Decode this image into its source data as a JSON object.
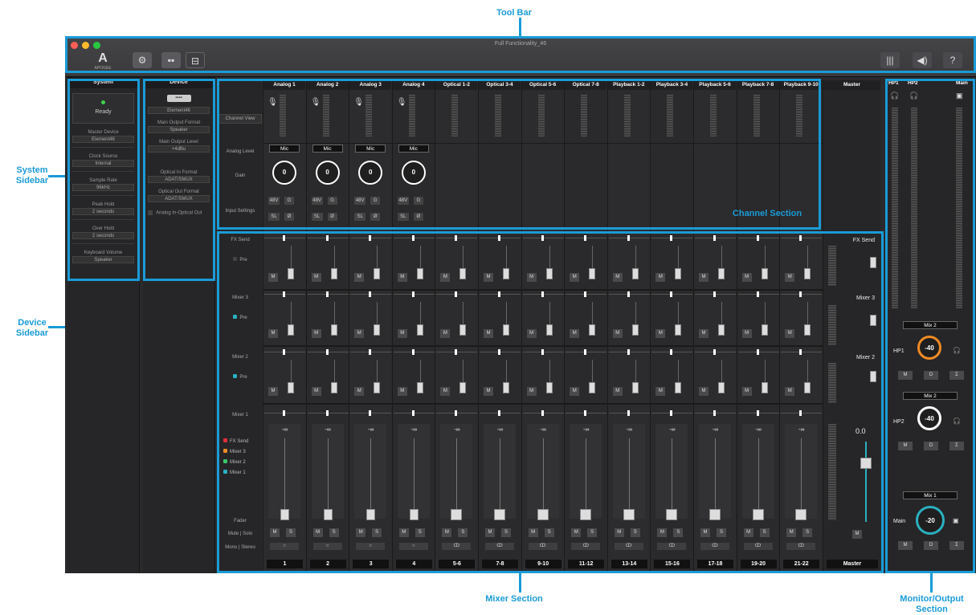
{
  "window": {
    "title": "Full Functionality_46"
  },
  "callouts": {
    "toolbar": "Tool Bar",
    "system_sidebar": "System\nSidebar",
    "device_sidebar": "Device\nSidebar",
    "channel_section": "Channel Section",
    "mixer_section": "Mixer Section",
    "monitor_section": "Monitor/Output\nSection"
  },
  "logo_text": "APOGEE",
  "system": {
    "header": "System",
    "status": "Ready",
    "status_color": "#3cd14a",
    "fields": [
      {
        "label": "Master Device",
        "value": "Element46"
      },
      {
        "label": "Clock Source",
        "value": "Internal"
      },
      {
        "label": "Sample Rate",
        "value": "96kHz"
      },
      {
        "label": "Peak Hold",
        "value": "2 seconds"
      },
      {
        "label": "Over Hold",
        "value": "2 seconds"
      },
      {
        "label": "Keyboard Volume",
        "value": "Speaker"
      }
    ]
  },
  "device": {
    "header": "Device",
    "name": "Element46",
    "fields": [
      {
        "label": "Main Output Format",
        "value": "Speaker"
      },
      {
        "label": "Main Output Level",
        "value": "+4dBu"
      },
      {
        "label": "Optical In Format",
        "value": "ADAT/SMUX"
      },
      {
        "label": "Optical Out Format",
        "value": "ADAT/SMUX"
      }
    ],
    "checkbox_label": "Analog In-Optical Out"
  },
  "row_labels": {
    "channel_view": "Channel View",
    "analog_level": "Analog Level",
    "gain": "Gain",
    "input_settings": "Input Settings",
    "fx_send": "FX Send",
    "pre": "Pre",
    "mixer3": "Mixer 3",
    "mixer2": "Mixer 2",
    "mixer1": "Mixer 1",
    "fader": "Fader",
    "mute_solo": "Mute | Solo",
    "mono_stereo": "Mono | Stereo"
  },
  "legend": [
    {
      "label": "FX Send",
      "color": "#e0303a"
    },
    {
      "label": "Mixer 3",
      "color": "#f08a24"
    },
    {
      "label": "Mixer 2",
      "color": "#3cc46a"
    },
    {
      "label": "Mixer 1",
      "color": "#2ab0c0"
    }
  ],
  "channels": [
    {
      "name": "Analog 1",
      "num": "1",
      "analog": true
    },
    {
      "name": "Analog 2",
      "num": "2",
      "analog": true
    },
    {
      "name": "Analog 3",
      "num": "3",
      "analog": true
    },
    {
      "name": "Analog 4",
      "num": "4",
      "analog": true
    },
    {
      "name": "Optical 1-2",
      "num": "5-6",
      "analog": false
    },
    {
      "name": "Optical 3-4",
      "num": "7-8",
      "analog": false
    },
    {
      "name": "Optical 5-6",
      "num": "9-10",
      "analog": false
    },
    {
      "name": "Optical 7-8",
      "num": "11-12",
      "analog": false
    },
    {
      "name": "Playback 1-2",
      "num": "13-14",
      "analog": false
    },
    {
      "name": "Playback 3-4",
      "num": "15-16",
      "analog": false
    },
    {
      "name": "Playback 5-6",
      "num": "17-18",
      "analog": false
    },
    {
      "name": "Playback 7-8",
      "num": "19-20",
      "analog": false
    },
    {
      "name": "Playback 9-10",
      "num": "21-22",
      "analog": false
    }
  ],
  "channel_controls": {
    "level": "Mic",
    "gain": "0",
    "btn48v": "48V",
    "btnG": "G",
    "btnSL": "SL",
    "btnPhase": "Ø",
    "mute": "M",
    "solo": "S",
    "fader_value": "-∞"
  },
  "master": {
    "header": "Master",
    "fx_send": "FX Send",
    "mixer3": "Mixer 3",
    "mixer2": "Mixer 2",
    "value": "0.0",
    "label": "Master",
    "mute": "M"
  },
  "monitor": {
    "headers": [
      "HP1",
      "HP2",
      "Main"
    ],
    "outputs": [
      {
        "mix": "Mix 2",
        "label": "HP1",
        "value": "-40",
        "ring": "#f08a24",
        "btns": [
          "M",
          "D",
          "Σ"
        ]
      },
      {
        "mix": "Mix 2",
        "label": "HP2",
        "value": "-40",
        "ring": "#ffffff",
        "btns": [
          "M",
          "D",
          "Σ"
        ]
      },
      {
        "mix": "Mix 1",
        "label": "Main",
        "value": "-20",
        "ring": "#2ab0c0",
        "btns": [
          "M",
          "D",
          "Σ"
        ]
      }
    ]
  }
}
